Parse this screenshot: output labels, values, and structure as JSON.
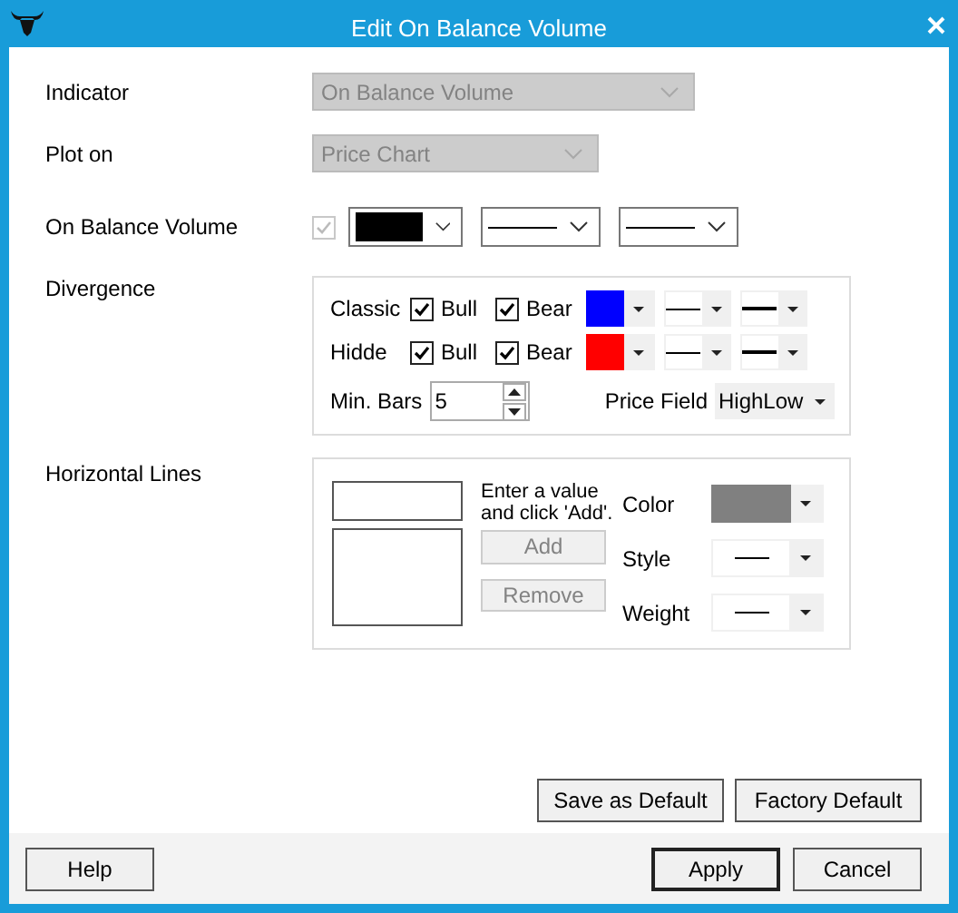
{
  "window": {
    "title": "Edit On Balance Volume"
  },
  "indicator": {
    "label": "Indicator",
    "value": "On Balance Volume",
    "disabled": true
  },
  "plot_on": {
    "label": "Plot on",
    "value": "Price Chart",
    "disabled": true
  },
  "series": {
    "label": "On Balance Volume",
    "checked": true,
    "disabled": true,
    "color": "#000000"
  },
  "divergence": {
    "label": "Divergence",
    "rows": [
      {
        "label": "Classic",
        "bull": {
          "label": "Bull",
          "checked": true
        },
        "bear": {
          "label": "Bear",
          "checked": true
        },
        "color": "#0000ff"
      },
      {
        "label": "Hidde",
        "bull": {
          "label": "Bull",
          "checked": true
        },
        "bear": {
          "label": "Bear",
          "checked": true
        },
        "color": "#ff0000"
      }
    ],
    "min_bars": {
      "label": "Min. Bars",
      "value": "5"
    },
    "price_field": {
      "label": "Price Field",
      "value": "HighLow"
    }
  },
  "horizontal_lines": {
    "label": "Horizontal Lines",
    "hint": "Enter a value and click 'Add'.",
    "add": {
      "label": "Add",
      "disabled": true
    },
    "remove": {
      "label": "Remove",
      "disabled": true
    },
    "color_label": "Color",
    "color": "#808080",
    "style_label": "Style",
    "weight_label": "Weight"
  },
  "default_buttons": [
    {
      "label": "Save as Default"
    },
    {
      "label": "Factory Default"
    }
  ],
  "footer": {
    "help": "Help",
    "buttons": [
      {
        "label": "Apply",
        "default": true
      },
      {
        "label": "Cancel",
        "default": false
      }
    ]
  }
}
